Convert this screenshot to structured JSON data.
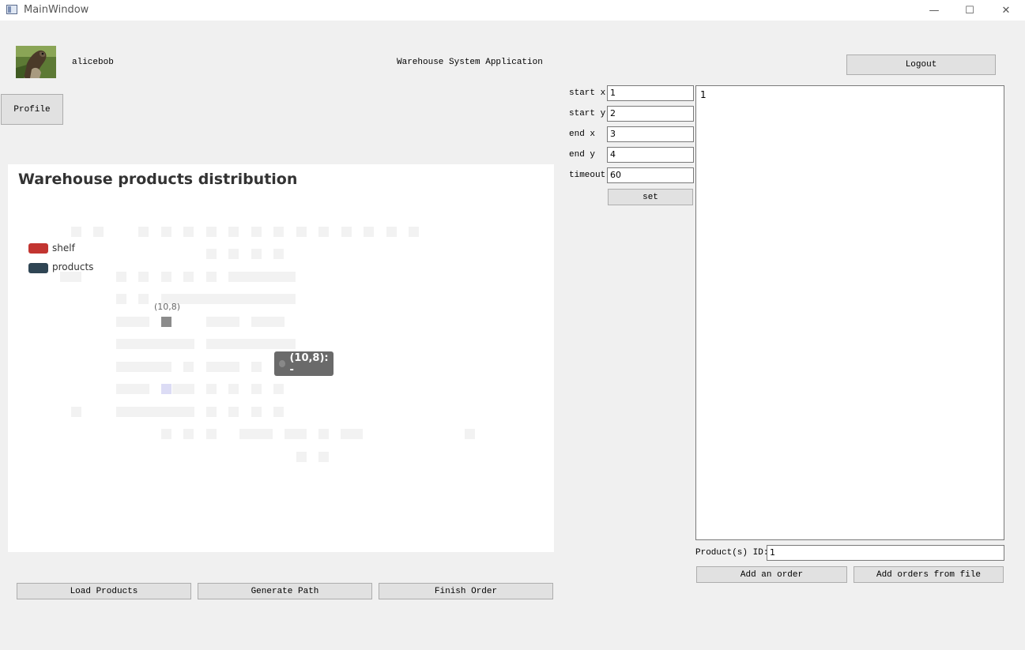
{
  "window": {
    "title": "MainWindow",
    "minimize": "—",
    "maximize": "☐",
    "close": "✕"
  },
  "user": {
    "name": "alicebob"
  },
  "app": {
    "title": "Warehouse System Application"
  },
  "buttons": {
    "logout": "Logout",
    "profile": "Profile",
    "set": "set",
    "load_products": "Load Products",
    "generate_path": "Generate Path",
    "finish_order": "Finish Order",
    "add_order": "Add an order",
    "add_orders_file": "Add orders from file"
  },
  "params": {
    "start_x": {
      "label": "start x",
      "value": "1"
    },
    "start_y": {
      "label": "start y",
      "value": "2"
    },
    "end_x": {
      "label": "end x",
      "value": "3"
    },
    "end_y": {
      "label": "end y",
      "value": "4"
    },
    "timeout": {
      "label": "timeout",
      "value": "60"
    }
  },
  "output": {
    "text": "1"
  },
  "product_ids": {
    "label": "Product(s) ID:",
    "value": "1"
  },
  "chart": {
    "title": "Warehouse products distribution",
    "legend": [
      {
        "name": "shelf",
        "color": "#c23531"
      },
      {
        "name": "products",
        "color": "#2f4554"
      }
    ],
    "highlight_label": "(10,8)",
    "tooltip": "(10,8): -"
  },
  "chart_data": {
    "type": "heatmap",
    "title": "Warehouse products distribution",
    "series": [
      {
        "name": "shelf",
        "color": "#c23531"
      },
      {
        "name": "products",
        "color": "#2f4554"
      }
    ],
    "legend_position": "left",
    "highlighted_cell": {
      "x": 10,
      "y": 8,
      "label": "(10,8)",
      "tooltip": "(10,8): -"
    }
  }
}
